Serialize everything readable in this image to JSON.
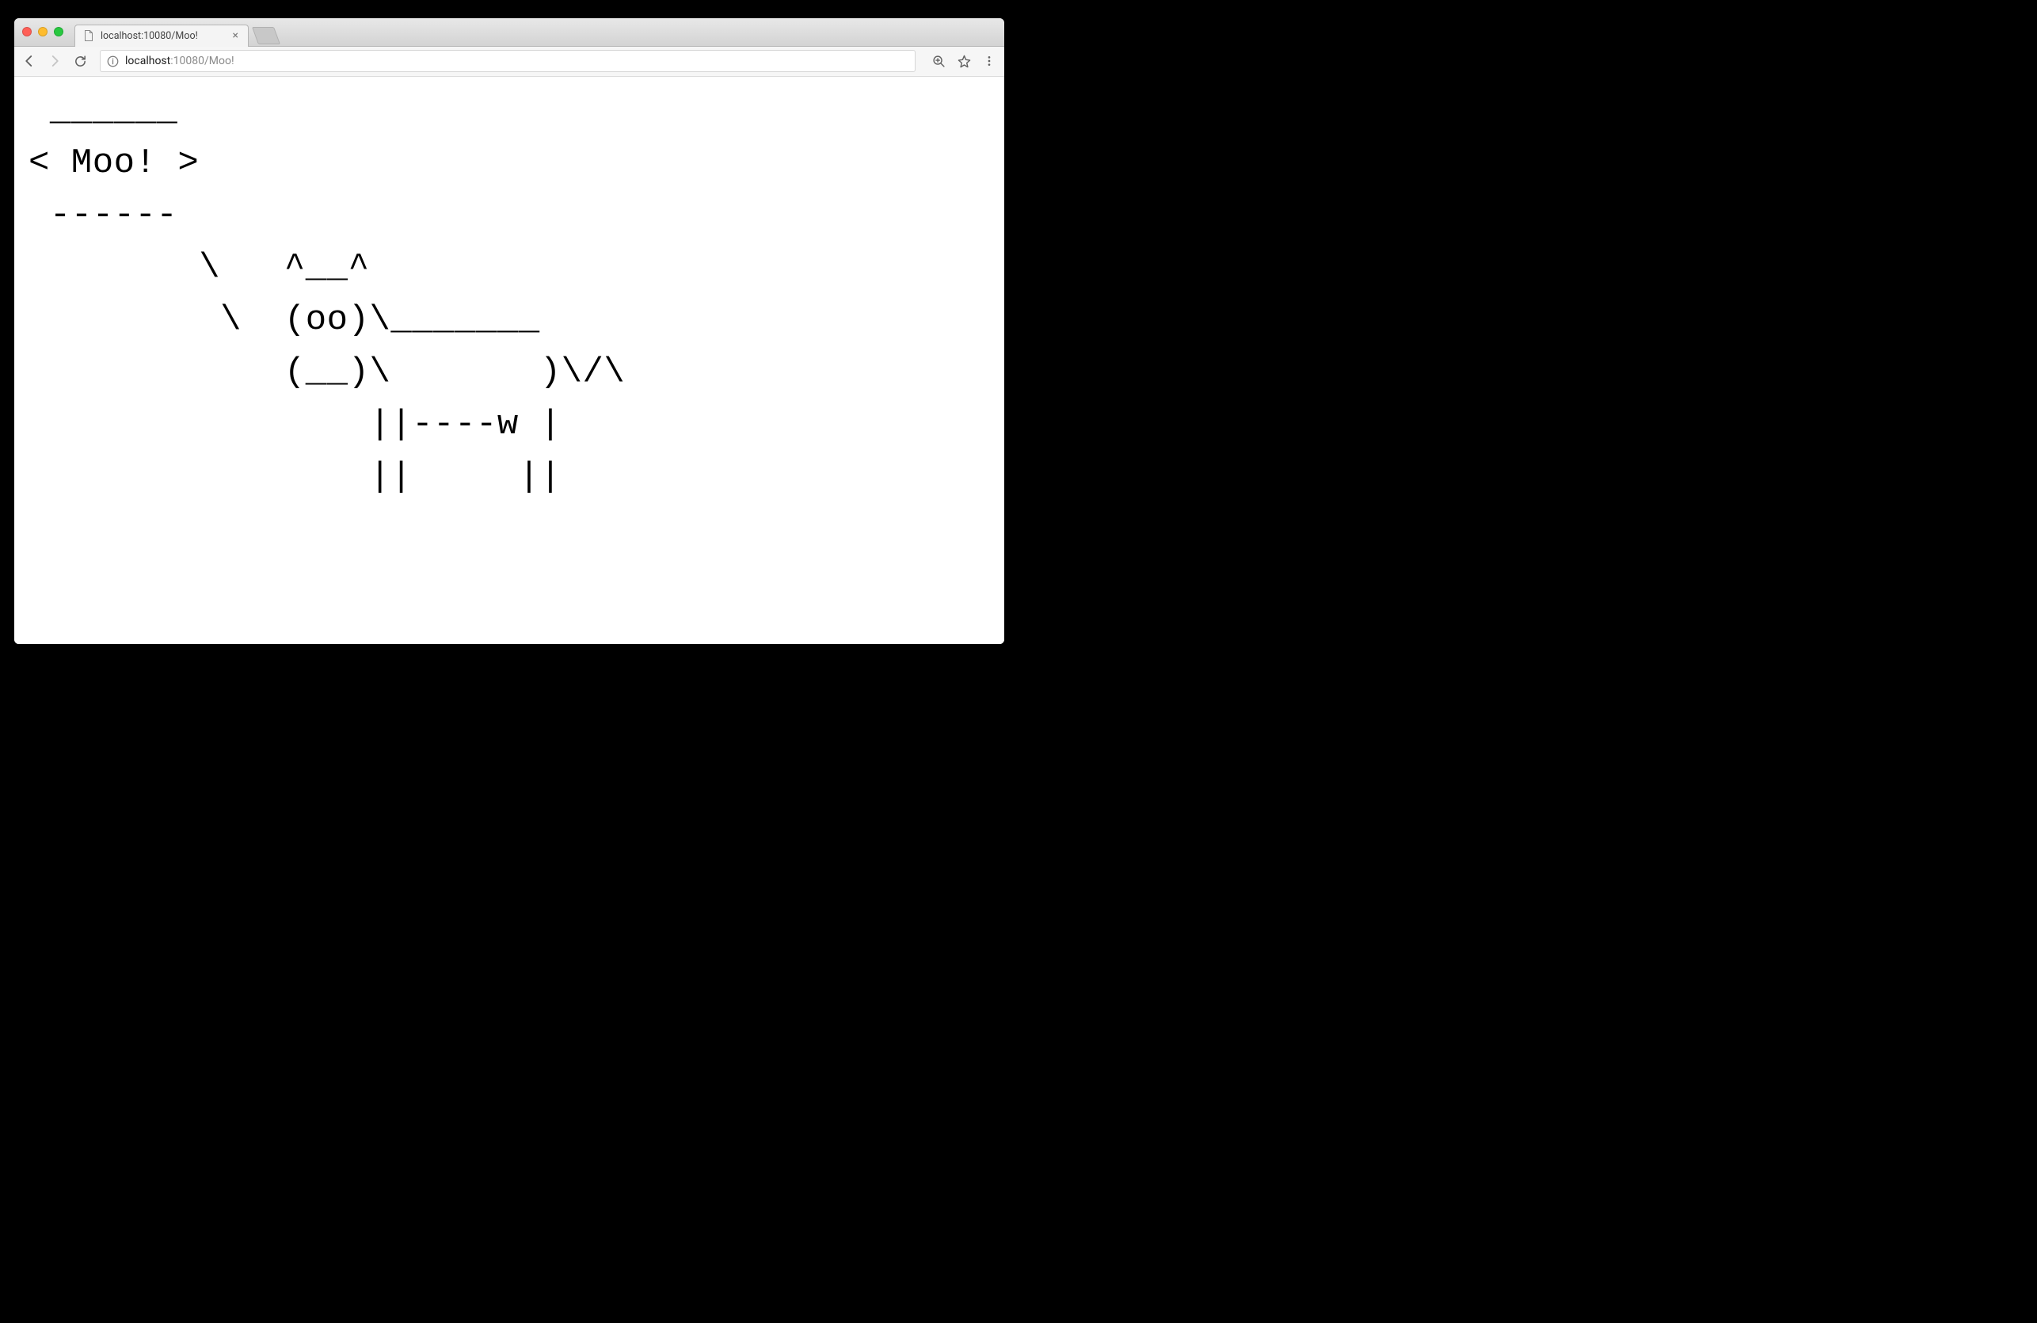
{
  "tab": {
    "title": "localhost:10080/Moo!"
  },
  "url": {
    "host": "localhost",
    "port": ":10080",
    "path": "/Moo!"
  },
  "cowsay": " ______\n< Moo! >\n ------\n        \\   ^__^\n         \\  (oo)\\_______\n            (__)\\       )\\/\\\n                ||----w |\n                ||     ||"
}
